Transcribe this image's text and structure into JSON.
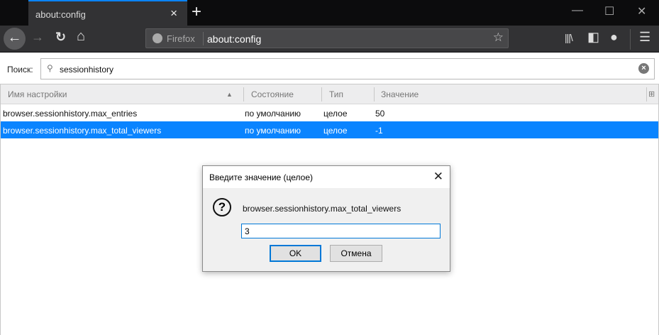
{
  "tab": {
    "title": "about:config",
    "close": "×",
    "new_tab": "+"
  },
  "window": {
    "minimize": "—",
    "maximize": "☐",
    "close": "✕"
  },
  "toolbar": {
    "back": "←",
    "forward": "→",
    "reload": "↻",
    "home": "⌂",
    "identity_label": "Firefox",
    "url": "about:config",
    "star": "☆",
    "library": "|||\\",
    "sidebar": "◧",
    "account": "●",
    "menu": "☰"
  },
  "search": {
    "label": "Поиск:",
    "value": "sessionhistory",
    "clear": "×"
  },
  "table": {
    "columns": [
      "Имя настройки",
      "Состояние",
      "Тип",
      "Значение"
    ],
    "sort_indicator": "▲",
    "column_picker": "⊞",
    "rows": [
      {
        "name": "browser.sessionhistory.max_entries",
        "state": "по умолчанию",
        "type": "целое",
        "value": "50",
        "selected": false
      },
      {
        "name": "browser.sessionhistory.max_total_viewers",
        "state": "по умолчанию",
        "type": "целое",
        "value": "-1",
        "selected": true
      }
    ]
  },
  "dialog": {
    "title": "Введите значение (целое)",
    "close": "✕",
    "icon": "?",
    "message": "browser.sessionhistory.max_total_viewers",
    "input_value": "3",
    "ok": "OK",
    "cancel": "Отмена"
  },
  "colors": {
    "accent": "#0a84ff",
    "chrome": "#323234",
    "tabbar": "#0c0c0d"
  }
}
